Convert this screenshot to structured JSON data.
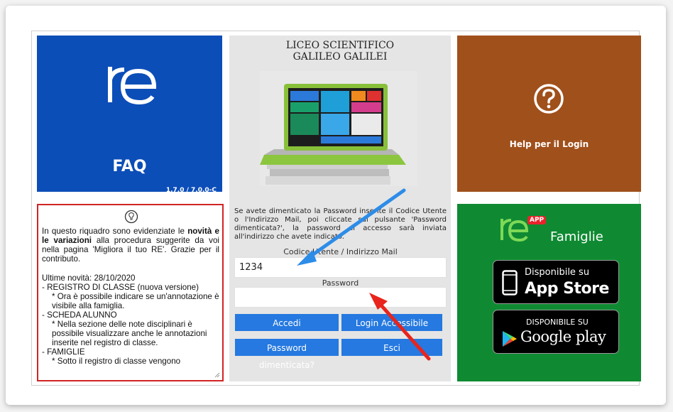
{
  "faq": {
    "title": "FAQ",
    "version": "1.7.0 / 7.0.0-C"
  },
  "login": {
    "school_line1": "LICEO SCIENTIFICO",
    "school_line2": "GALILEO GALILEI",
    "hint": "Se avete dimenticato la Password inserite il Codice Utente o l'Indirizzo Mail, poi cliccate sul pulsante 'Password dimenticata?', la password di accesso sarà inviata all'indirizzo che avete indicato.",
    "user_label": "Codice Utente / Indirizzo Mail",
    "user_value": "1234",
    "password_label": "Password",
    "password_value": "",
    "accedi": "Accedi",
    "login_accessibile": "Login Accessibile",
    "password_dimenticata": "Password dimenticata?",
    "esci": "Esci"
  },
  "help": {
    "label": "Help per il Login"
  },
  "famiglie": {
    "app_badge": "APP",
    "label": "Famiglie",
    "appstore_small": "Disponibile su",
    "appstore_big": "App Store",
    "googleplay_small": "DISPONIBILE SU",
    "googleplay_big": "Google play"
  },
  "news": {
    "intro_pre": "In questo riquadro sono evidenziate le ",
    "intro_bold": "novità e le variazioni",
    "intro_post": " alla procedura suggerite da voi nella pagina 'Migliora il tuo RE'. Grazie per il contributo.",
    "lines": [
      "Ultime novità: 28/10/2020",
      "- REGISTRO DI CLASSE (nuova versione)",
      "  * Ora è possibile indicare se un'annotazione è visibile alla famiglia.",
      "- SCHEDA ALUNNO",
      "  * Nella sezione delle note disciplinari è possibile visualizzare anche le annotazioni inserite nel registro di classe.",
      "- FAMIGLIE",
      "  * Sotto il registro di classe vengono"
    ]
  },
  "colors": {
    "faq_blue": "#0c4eb8",
    "help_brown": "#a0501b",
    "famiglie_green": "#0f8a32",
    "button_blue": "#2579e0",
    "news_border_red": "#d22424",
    "annotation_blue_arrow": "#2d8ce8",
    "annotation_red_arrow": "#e8241c"
  }
}
